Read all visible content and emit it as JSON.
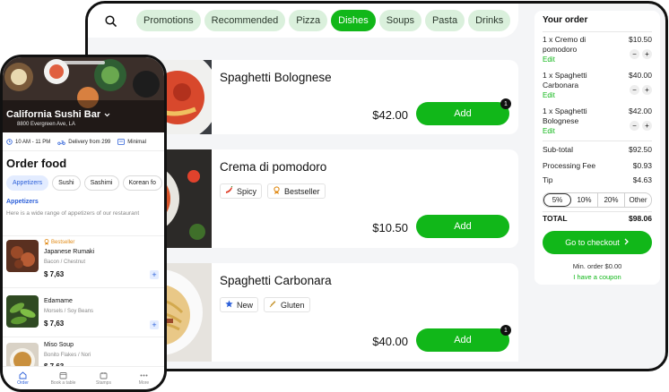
{
  "desktop": {
    "categories": [
      "Promotions",
      "Recommended",
      "Pizza",
      "Dishes",
      "Soups",
      "Pasta",
      "Drinks"
    ],
    "active_category": "Dishes",
    "dishes": [
      {
        "name": "Spaghetti Bolognese",
        "price": "$42.00",
        "add_label": "Add",
        "badge": "1",
        "tags": []
      },
      {
        "name": "Crema di pomodoro",
        "price": "$10.50",
        "add_label": "Add",
        "badge": "",
        "tags": [
          {
            "icon": "chili-icon",
            "label": "Spicy"
          },
          {
            "icon": "bestseller-icon",
            "label": "Bestseller"
          }
        ]
      },
      {
        "name": "Spaghetti Carbonara",
        "price": "$40.00",
        "add_label": "Add",
        "badge": "1",
        "tags": [
          {
            "icon": "star-icon",
            "label": "New"
          },
          {
            "icon": "wheat-icon",
            "label": "Gluten"
          }
        ]
      }
    ],
    "order": {
      "title": "Your order",
      "items": [
        {
          "qty_name": "1 x Cremo di pomodoro",
          "price": "$10.50",
          "edit": "Edit"
        },
        {
          "qty_name": "1 x Spaghetti Carbonara",
          "price": "$40.00",
          "edit": "Edit"
        },
        {
          "qty_name": "1 x Spaghetti Bolognese",
          "price": "$42.00",
          "edit": "Edit"
        }
      ],
      "subtotal_label": "Sub-total",
      "subtotal": "$92.50",
      "fee_label": "Processing Fee",
      "fee": "$0.93",
      "tip_label": "Tip",
      "tip": "$4.63",
      "tip_options": [
        "5%",
        "10%",
        "20%",
        "Other"
      ],
      "selected_tip": "5%",
      "total_label": "TOTAL",
      "total": "$98.06",
      "checkout_label": "Go to checkout",
      "min_order": "Min. order $0.00",
      "coupon": "I have a coupon"
    }
  },
  "phone": {
    "restaurant": "California Sushi Bar",
    "address": "8800 Evergreen Ave, LA",
    "info": [
      "10 AM - 11 PM",
      "Delivery from 299",
      "Minimal"
    ],
    "title": "Order food",
    "tabs": [
      "Appetizers",
      "Sushi",
      "Sashimi",
      "Korean fo"
    ],
    "section": "Appetizers",
    "description": "Here is a wide range of appetizers of our restaurant",
    "items": [
      {
        "badge": "Bestseller",
        "name": "Japanese Rumaki",
        "sub": "Bacon / Chestnut",
        "price": "$ 7,63"
      },
      {
        "badge": "",
        "name": "Edamame",
        "sub": "Morsels / Soy Beans",
        "price": "$ 7,63"
      },
      {
        "badge": "",
        "name": "Miso Soup",
        "sub": "Bonito Flakes / Nori",
        "price": "$ 7,63"
      }
    ],
    "nav": [
      "Order",
      "Book a table",
      "Stamps",
      "More"
    ]
  },
  "colors": {
    "accent_green": "#11b719",
    "accent_blue": "#2b5fd9",
    "bestseller_orange": "#e08a16"
  }
}
